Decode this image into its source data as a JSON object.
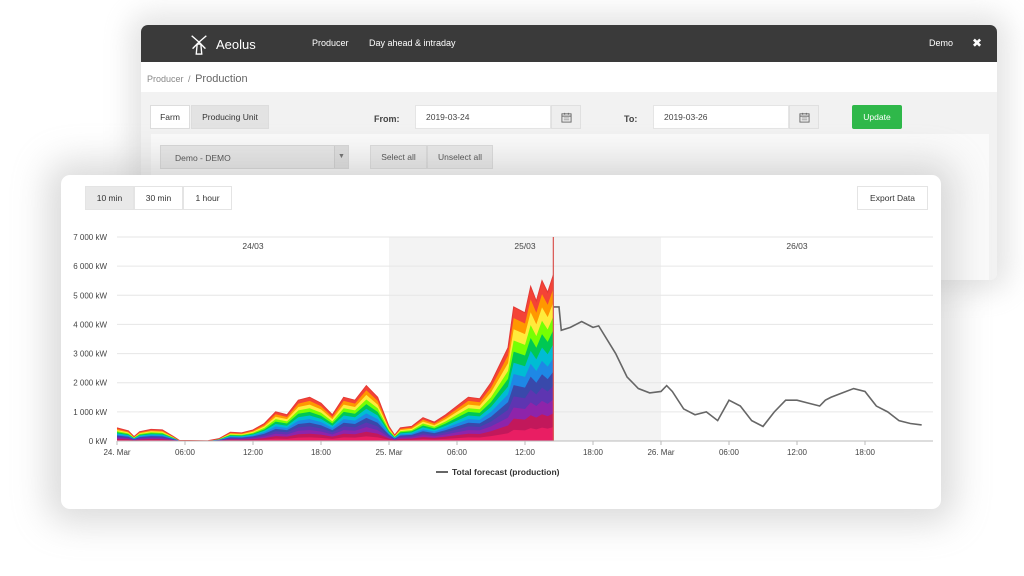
{
  "app": {
    "title": "Aeolus",
    "nav": {
      "producer": "Producer",
      "day_ahead": "Day ahead & intraday",
      "user": "Demo",
      "close": "✖"
    }
  },
  "breadcrumb": {
    "parent": "Producer",
    "separator": "/",
    "current": "Production"
  },
  "filters": {
    "farm_tab": "Farm",
    "producing_unit_tab": "Producing Unit",
    "from_label": "From:",
    "from_value": "2019-03-24",
    "to_label": "To:",
    "to_value": "2019-03-26",
    "update_button": "Update",
    "unit_select": "Demo - DEMO",
    "select_all": "Select all",
    "unselect_all": "Unselect all"
  },
  "chart_controls": {
    "tabs": [
      "10 min",
      "30 min",
      "1 hour"
    ],
    "active_tab": "10 min",
    "export_button": "Export Data"
  },
  "colors": {
    "accent_green": "#2fb84a",
    "topbar": "#3a3a3a",
    "now_line": "#d9534f",
    "forecast_line": "#666666"
  },
  "chart_data": {
    "type": "area",
    "x_unit": "hours from 24. Mar 00:00",
    "xlim": [
      0,
      72
    ],
    "ylim": [
      0,
      7000
    ],
    "y_ticks": [
      "0 kW",
      "1 000 kW",
      "2 000 kW",
      "3 000 kW",
      "4 000 kW",
      "5 000 kW",
      "6 000 kW",
      "7 000 kW"
    ],
    "y_tick_values": [
      0,
      1000,
      2000,
      3000,
      4000,
      5000,
      6000,
      7000
    ],
    "x_ticks": [
      "24. Mar",
      "06:00",
      "12:00",
      "18:00",
      "25. Mar",
      "06:00",
      "12:00",
      "18:00",
      "26. Mar",
      "06:00",
      "12:00",
      "18:00"
    ],
    "x_tick_values": [
      0,
      6,
      12,
      18,
      24,
      30,
      36,
      42,
      48,
      54,
      60,
      66
    ],
    "day_bands": [
      {
        "label": "24/03",
        "start": 0,
        "end": 24,
        "shaded": false
      },
      {
        "label": "25/03",
        "start": 24,
        "end": 48,
        "shaded": true
      },
      {
        "label": "26/03",
        "start": 48,
        "end": 72,
        "shaded": false
      }
    ],
    "now_marker": 38.5,
    "grid": true,
    "legend": "bottom-center",
    "production_total": [
      [
        0,
        450
      ],
      [
        1,
        350
      ],
      [
        1.5,
        150
      ],
      [
        2,
        320
      ],
      [
        3,
        400
      ],
      [
        4,
        380
      ],
      [
        5,
        150
      ],
      [
        5.5,
        20
      ],
      [
        8,
        10
      ],
      [
        9,
        80
      ],
      [
        10,
        300
      ],
      [
        11,
        280
      ],
      [
        12,
        380
      ],
      [
        13,
        600
      ],
      [
        14,
        1000
      ],
      [
        15,
        900
      ],
      [
        16,
        1400
      ],
      [
        17,
        1500
      ],
      [
        18,
        1300
      ],
      [
        19,
        900
      ],
      [
        20,
        1500
      ],
      [
        21,
        1400
      ],
      [
        22,
        1900
      ],
      [
        23,
        1500
      ],
      [
        24,
        500
      ],
      [
        24.5,
        200
      ],
      [
        25,
        450
      ],
      [
        26,
        500
      ],
      [
        27,
        800
      ],
      [
        28,
        650
      ],
      [
        29,
        900
      ],
      [
        30,
        1200
      ],
      [
        31,
        1500
      ],
      [
        32,
        1450
      ],
      [
        33,
        2000
      ],
      [
        34,
        2800
      ],
      [
        34.5,
        3200
      ],
      [
        35,
        4600
      ],
      [
        36,
        4400
      ],
      [
        36.5,
        5300
      ],
      [
        37,
        4800
      ],
      [
        37.5,
        5500
      ],
      [
        38,
        5100
      ],
      [
        38.5,
        5700
      ]
    ],
    "production_series_count": 12,
    "series": [
      {
        "name": "Total forecast (production)",
        "color": "#666666",
        "values": [
          [
            38.5,
            4600
          ],
          [
            39,
            4600
          ],
          [
            39.2,
            3800
          ],
          [
            40,
            3900
          ],
          [
            41,
            4100
          ],
          [
            42,
            3900
          ],
          [
            42.5,
            3950
          ],
          [
            44,
            3000
          ],
          [
            45,
            2200
          ],
          [
            46,
            1800
          ],
          [
            47,
            1650
          ],
          [
            48,
            1700
          ],
          [
            48.5,
            1900
          ],
          [
            49,
            1700
          ],
          [
            50,
            1100
          ],
          [
            51,
            900
          ],
          [
            52,
            1000
          ],
          [
            53,
            700
          ],
          [
            54,
            1400
          ],
          [
            55,
            1200
          ],
          [
            56,
            700
          ],
          [
            57,
            500
          ],
          [
            58,
            1000
          ],
          [
            59,
            1400
          ],
          [
            60,
            1400
          ],
          [
            61,
            1300
          ],
          [
            62,
            1200
          ],
          [
            62.5,
            1400
          ],
          [
            63,
            1500
          ],
          [
            64,
            1650
          ],
          [
            65,
            1800
          ],
          [
            66,
            1700
          ],
          [
            67,
            1200
          ],
          [
            68,
            1000
          ],
          [
            69,
            700
          ],
          [
            70,
            600
          ],
          [
            71,
            550
          ]
        ]
      }
    ]
  }
}
